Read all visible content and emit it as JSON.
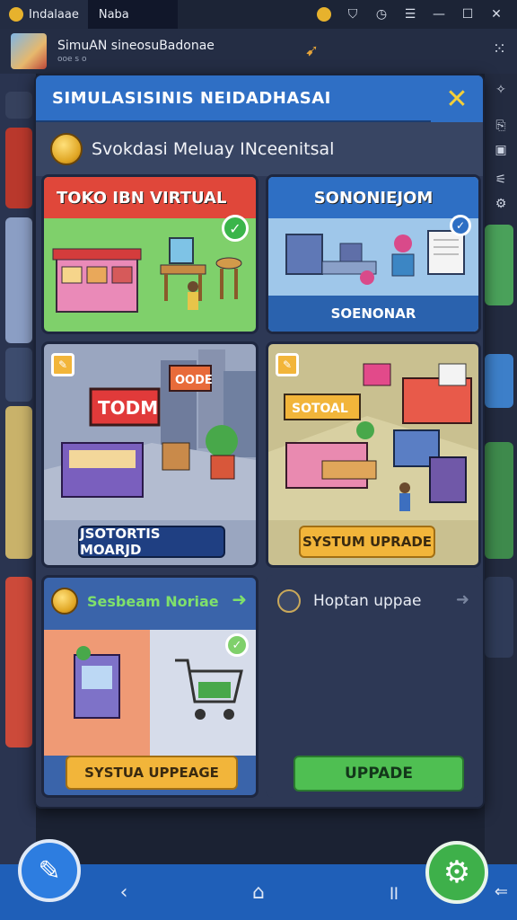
{
  "window": {
    "tab_active": "Indalaae",
    "tab_second": "Naba"
  },
  "app": {
    "title": "SimuAN sineosuBadonae",
    "subtitle": "ooe s o"
  },
  "dialog": {
    "title": "SIMULASISINIS NEIDADHASAI",
    "subheading": "Svokdasi Meluay INceenitsal"
  },
  "cards": [
    {
      "title": "TOKO IBN VIRTUAL",
      "color": "#e0473a"
    },
    {
      "title": "SONONIEJOM",
      "footer": "SOENONAR",
      "color": "#2e6fc4"
    },
    {
      "sign": "TODM",
      "sign2": "OODE",
      "tag": "",
      "button": "JSOTORTIS MOARJD"
    },
    {
      "sign": "SOTOAL",
      "button": "SYSTUM UPRADE"
    },
    {
      "title": "Sesbeam Noriae",
      "button": "SYSTUA UPPEAGE"
    },
    {
      "title": "Hoptan uppae",
      "button": "UPPADE"
    }
  ],
  "colors": {
    "accent_blue": "#2f6fc5",
    "close_yellow": "#f3cf3a",
    "green": "#3eb04a",
    "button_gold": "#f2b53a"
  },
  "icons": {
    "close": "close-icon",
    "settings": "gear-icon",
    "pen": "pen-icon",
    "back": "back-icon",
    "home": "home-icon",
    "recents": "recents-icon"
  }
}
